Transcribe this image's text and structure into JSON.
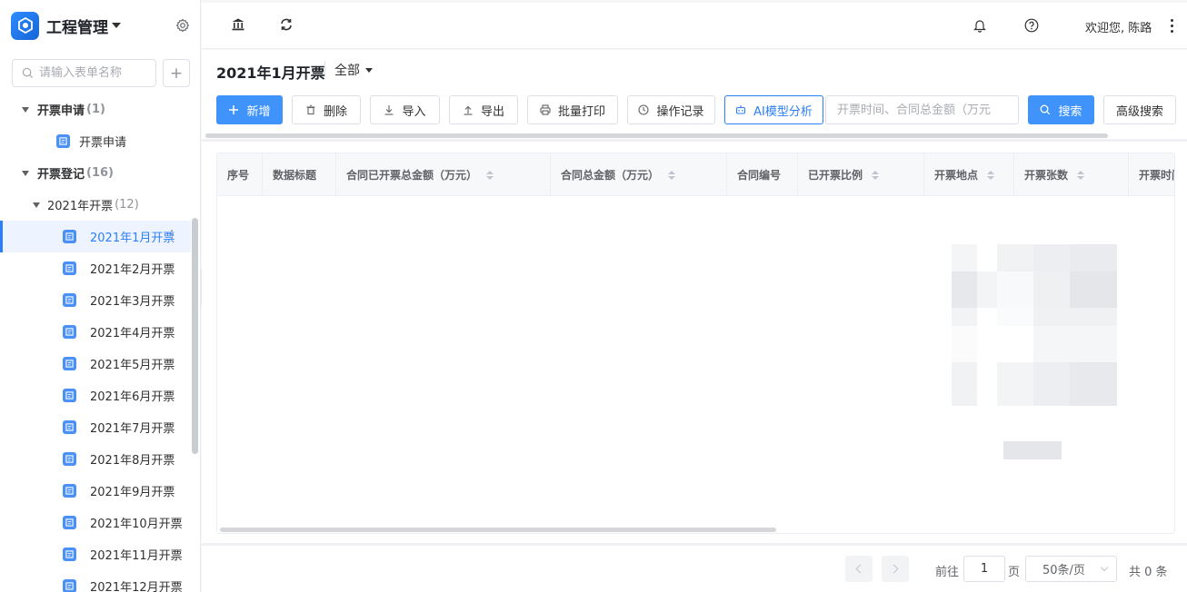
{
  "app": {
    "title": "工程管理"
  },
  "sidebar": {
    "search_placeholder": "请输入表单名称",
    "add_label": "+",
    "groups": [
      {
        "label": "开票申请",
        "count": "(1)"
      },
      {
        "label": "开票登记",
        "count": "(16)"
      }
    ],
    "apply_item": "开票申请",
    "subgroup": {
      "label": "2021年开票",
      "count": "(12)"
    },
    "months": [
      "2021年1月开票",
      "2021年2月开票",
      "2021年3月开票",
      "2021年4月开票",
      "2021年5月开票",
      "2021年6月开票",
      "2021年7月开票",
      "2021年8月开票",
      "2021年9月开票",
      "2021年10月开票",
      "2021年11月开票",
      "2021年12月开票"
    ],
    "active_index": 0
  },
  "topbar": {
    "welcome": "欢迎您, 陈路",
    "icons": [
      "bank-icon",
      "refresh-icon",
      "bell-icon",
      "help-icon",
      "more-vertical-icon"
    ]
  },
  "page": {
    "title": "2021年1月开票",
    "view": "全部"
  },
  "toolbar": {
    "new": "新增",
    "delete": "删除",
    "import": "导入",
    "export": "导出",
    "batch_print": "批量打印",
    "operation_log": "操作记录",
    "ai_analysis": "AI模型分析",
    "search_placeholder": "开票时间、合同总金额（万元",
    "search": "搜索",
    "advanced_search": "高级搜索"
  },
  "table": {
    "columns": [
      "序号",
      "数据标题",
      "合同已开票总金额（万元）",
      "合同总金额（万元）",
      "合同编号",
      "已开票比例",
      "开票地点",
      "开票张数",
      "开票时间"
    ],
    "rows": []
  },
  "pagination": {
    "goto_label": "前往",
    "page_value": "1",
    "page_unit": "页",
    "page_size": "50条/页",
    "total": "共 0 条"
  },
  "colors": {
    "primary": "#3f93fa",
    "active": "#2d7ff9"
  }
}
